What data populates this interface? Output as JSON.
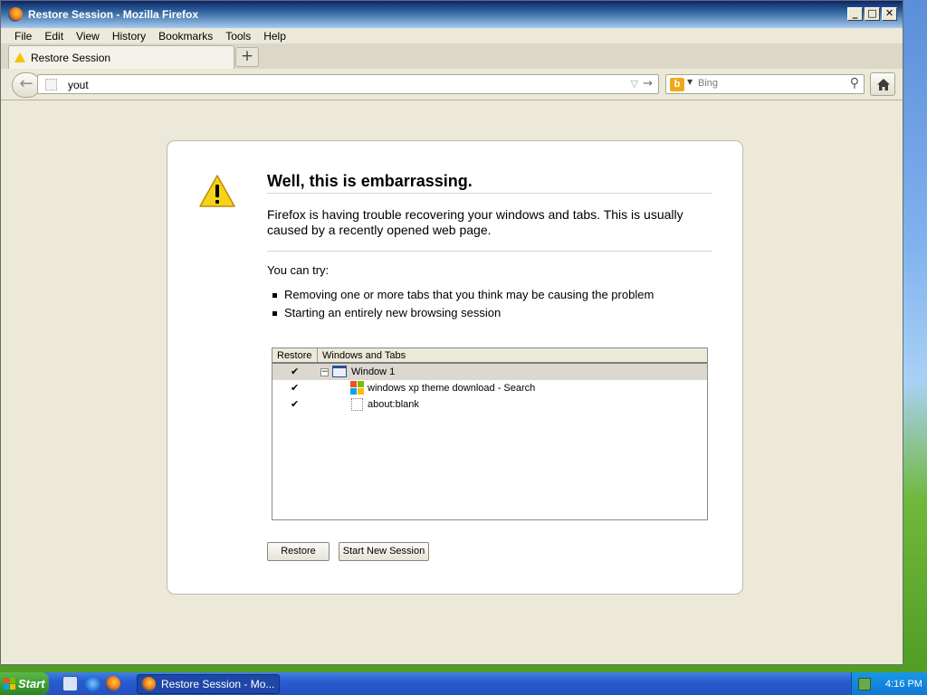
{
  "window": {
    "title": "Restore Session - Mozilla Firefox",
    "controls": {
      "minimize": "_",
      "maximize": "□",
      "close": "✕"
    }
  },
  "menu": [
    "File",
    "Edit",
    "View",
    "History",
    "Bookmarks",
    "Tools",
    "Help"
  ],
  "tab": {
    "label": "Restore Session",
    "newtab": "+"
  },
  "nav": {
    "url_value": "yout",
    "search_engine": "Bing",
    "search_placeholder": "Bing"
  },
  "page": {
    "heading": "Well, this is embarrassing.",
    "description": "Firefox is having trouble recovering your windows and tabs. This is usually caused by a recently opened web page.",
    "try_label": "You can try:",
    "suggestions": [
      "Removing one or more tabs that you think may be causing the problem",
      "Starting an entirely new browsing session"
    ],
    "tree": {
      "col_restore": "Restore",
      "col_windows": "Windows and Tabs",
      "rows": [
        {
          "checked": "✔",
          "label": "Window 1",
          "type": "window"
        },
        {
          "checked": "✔",
          "label": "windows xp theme download - Search",
          "type": "tab"
        },
        {
          "checked": "✔",
          "label": "about:blank",
          "type": "tab"
        }
      ]
    },
    "buttons": {
      "restore": "Restore",
      "new_session": "Start New Session"
    }
  },
  "taskbar": {
    "start": "Start",
    "task_button": "Restore Session - Mo...",
    "clock": "4:16 PM"
  },
  "colors": {
    "accent": "#2451c2",
    "warning": "#f5c400"
  }
}
